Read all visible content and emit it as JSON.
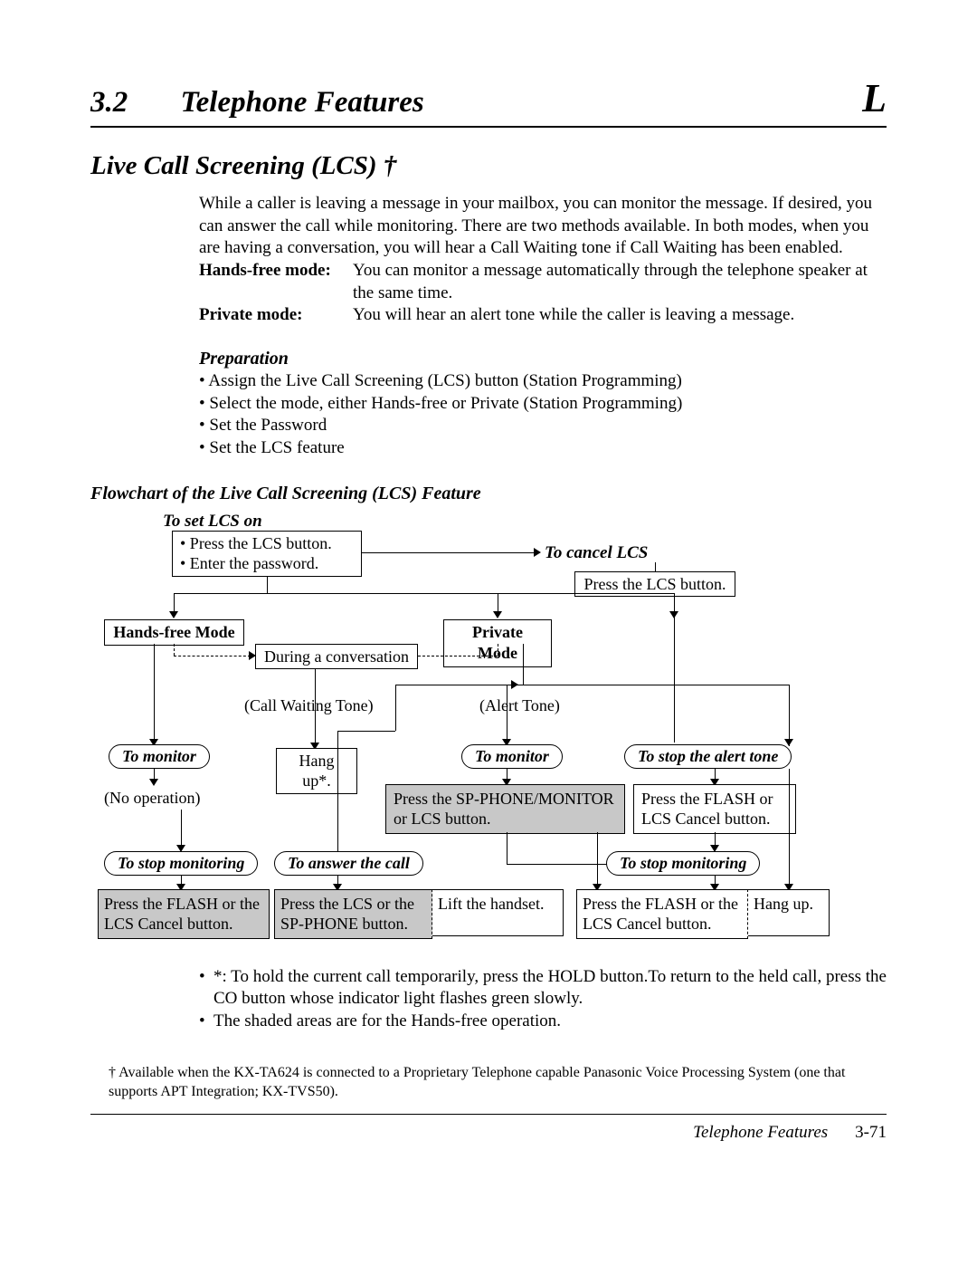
{
  "header": {
    "section_number": "3.2",
    "section_title": "Telephone Features",
    "section_letter": "L"
  },
  "title": "Live Call Screening (LCS) †",
  "intro": "While a caller is leaving a message in your mailbox, you can monitor the message. If desired, you can answer the call while monitoring. There are two methods available. In both modes, when you are having a conversation, you will hear a Call Waiting tone if Call Waiting has been enabled.",
  "modes": {
    "handsfree_label": "Hands-free mode:",
    "handsfree_text": "You can monitor a message automatically through the telephone speaker at the same time.",
    "private_label": "Private mode:",
    "private_text": "You will hear an alert tone while the caller is leaving a message."
  },
  "preparation": {
    "heading": "Preparation",
    "items": [
      "Assign the Live Call Screening (LCS) button (Station Programming)",
      "Select the mode, either Hands-free or Private (Station Programming)",
      "Set the Password",
      "Set the LCS feature"
    ]
  },
  "flowchart": {
    "title": "Flowchart of the Live Call Screening (LCS) Feature",
    "to_set_lcs_on": "To set LCS on",
    "set_on_box_l1": "• Press the LCS button.",
    "set_on_box_l2": "• Enter the password.",
    "to_cancel_lcs": "To cancel LCS",
    "cancel_box": "Press the LCS button.",
    "handsfree_mode": "Hands-free Mode",
    "private_mode": "Private Mode",
    "during_conv": "During a conversation",
    "call_waiting_tone": "(Call Waiting Tone)",
    "alert_tone": "(Alert Tone)",
    "to_monitor": "To monitor",
    "hang_up_star": "Hang up*.",
    "no_operation": "(No operation)",
    "sp_phone_box": "Press the SP-PHONE/MONITOR or LCS button.",
    "to_stop_alert": "To stop the alert tone",
    "flash_cancel_box": "Press the FLASH or LCS Cancel button.",
    "to_stop_monitoring": "To stop monitoring",
    "to_answer_call": "To answer the call",
    "flash_lcs_cancel": "Press the FLASH or the LCS Cancel button.",
    "press_lcs_spphone": "Press the LCS or the SP-PHONE button.",
    "lift_handset": "Lift the handset.",
    "hang_up": "Hang up."
  },
  "notes": {
    "n1": "*: To hold the current call temporarily, press the HOLD button.To return to the held call, press the CO button whose indicator light flashes green slowly.",
    "n2": "The shaded areas are for the Hands-free operation."
  },
  "footnote": "† Available when the KX-TA624 is connected to a Proprietary Telephone capable Panasonic Voice Processing System (one that supports APT Integration; KX-TVS50).",
  "footer": {
    "title": "Telephone Features",
    "page": "3-71"
  }
}
